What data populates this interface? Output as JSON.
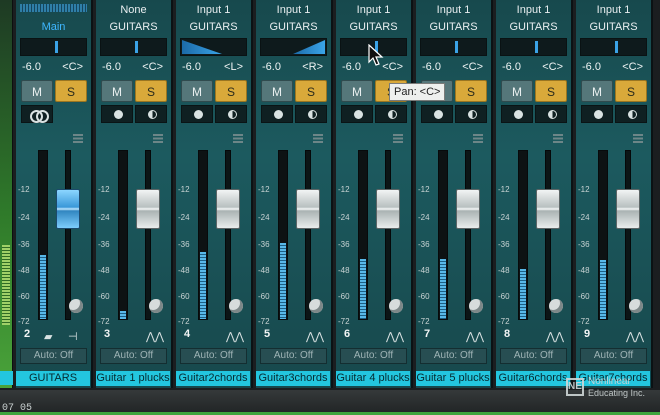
{
  "channels": [
    {
      "number": "2",
      "input": "",
      "output": "Main",
      "is_main": true,
      "volume": "-6.0",
      "pan": "<C>",
      "mute": "M",
      "solo": "S",
      "label": "GUITARS",
      "automation": "Auto: Off",
      "pan_type": "center",
      "fader_color": "blue"
    },
    {
      "number": "3",
      "input": "None",
      "output": "GUITARS",
      "volume": "-6.0",
      "pan": "<C>",
      "mute": "M",
      "solo": "S",
      "label": "Guitar 1 plucks",
      "automation": "Auto: Off",
      "pan_type": "center"
    },
    {
      "number": "4",
      "input": "Input 1",
      "output": "GUITARS",
      "volume": "-6.0",
      "pan": "<L>",
      "mute": "M",
      "solo": "S",
      "label": "Guitar2chords",
      "automation": "Auto: Off",
      "pan_type": "left"
    },
    {
      "number": "5",
      "input": "Input 1",
      "output": "GUITARS",
      "volume": "-6.0",
      "pan": "<R>",
      "mute": "M",
      "solo": "S",
      "label": "Guitar3chords",
      "automation": "Auto: Off",
      "pan_type": "right"
    },
    {
      "number": "6",
      "input": "Input 1",
      "output": "GUITARS",
      "volume": "-6.0",
      "pan": "<C>",
      "mute": "M",
      "solo": "S",
      "label": "Guitar 4 plucks",
      "automation": "Auto: Off",
      "pan_type": "center"
    },
    {
      "number": "7",
      "input": "Input 1",
      "output": "GUITARS",
      "volume": "-6.0",
      "pan": "<C>",
      "mute": "M",
      "solo": "S",
      "label": "Guitar 5 plucks",
      "automation": "Auto: Off",
      "pan_type": "center"
    },
    {
      "number": "8",
      "input": "Input 1",
      "output": "GUITARS",
      "volume": "-6.0",
      "pan": "<C>",
      "mute": "M",
      "solo": "S",
      "label": "Guitar6chords",
      "automation": "Auto: Off",
      "pan_type": "center"
    },
    {
      "number": "9",
      "input": "Input 1",
      "output": "GUITARS",
      "volume": "-6.0",
      "pan": "<C>",
      "mute": "M",
      "solo": "S",
      "label": "Guitar7chords",
      "automation": "Auto: Off",
      "pan_type": "center"
    }
  ],
  "meter_scale": [
    "-12",
    "-24",
    "-36",
    "-48",
    "-60",
    "-72"
  ],
  "meter_levels": [
    0.38,
    0.05,
    0.4,
    0.45,
    0.36,
    0.36,
    0.3,
    0.35
  ],
  "tooltip": "Pan: <C>",
  "bottom_bar": {
    "timestamp": "07 05"
  },
  "watermark": {
    "logo": "NE",
    "line1": "Nonlinear",
    "line2": "Educating Inc."
  },
  "colors": {
    "accent_label": "#23c6df",
    "solo": "#d9a93a",
    "meter": "#58b8e8"
  }
}
